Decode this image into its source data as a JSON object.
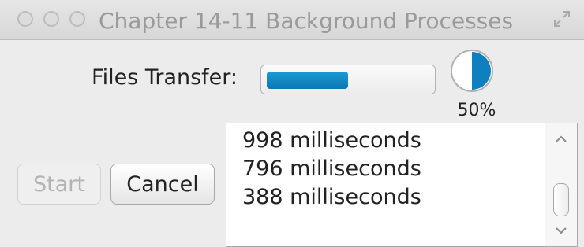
{
  "window": {
    "title": "Chapter 14-11 Background Processes"
  },
  "transfer": {
    "label": "Files Transfer:",
    "progress_fraction": 0.5,
    "percent_text": "50%"
  },
  "buttons": {
    "start_label": "Start",
    "start_enabled": false,
    "cancel_label": "Cancel"
  },
  "log": {
    "lines": [
      "998 milliseconds",
      "796 milliseconds",
      "388 milliseconds"
    ]
  },
  "icons": {
    "traffic_lights": [
      "close-icon",
      "minimize-icon",
      "zoom-icon"
    ],
    "fullscreen": "fullscreen-icon",
    "scroll_up": "chevron-up-icon",
    "scroll_down": "chevron-down-icon"
  },
  "colors": {
    "accent": "#0e80bf"
  }
}
